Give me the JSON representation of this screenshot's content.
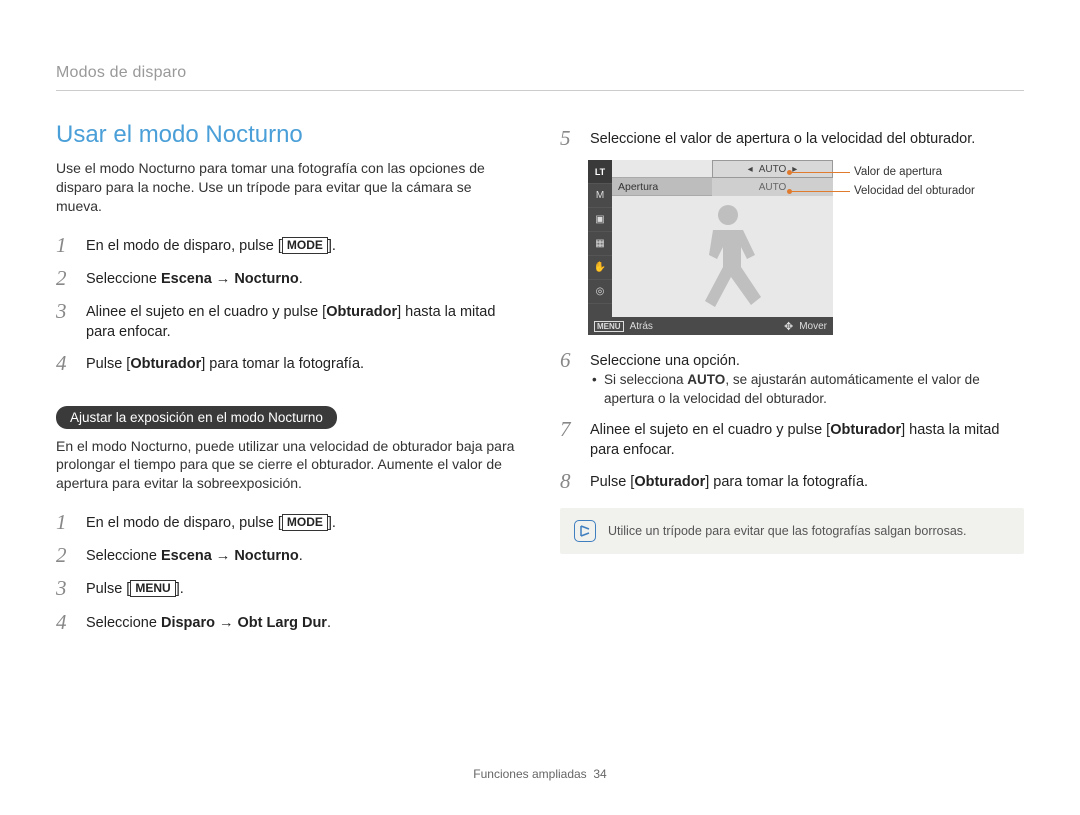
{
  "breadcrumb": "Modos de disparo",
  "section_title": "Usar el modo Nocturno",
  "intro": "Use el modo Nocturno para tomar una fotografía con las opciones de disparo para la noche. Use un trípode para evitar que la cámara se mueva.",
  "steps_a": [
    {
      "num": "1",
      "pre": "En el modo de disparo, pulse [",
      "key": "MODE",
      "post": "]."
    },
    {
      "num": "2",
      "html": "Seleccione <b>Escena</b> → <b>Nocturno</b>."
    },
    {
      "num": "3",
      "html": "Alinee el sujeto en el cuadro y pulse [<b>Obturador</b>] hasta la mitad para enfocar."
    },
    {
      "num": "4",
      "html": "Pulse [<b>Obturador</b>] para tomar la fotografía."
    }
  ],
  "pill": "Ajustar la exposición en el modo Nocturno",
  "sub_text": "En el modo Nocturno, puede utilizar una velocidad de obturador baja para prolongar el tiempo para que se cierre el obturador. Aumente el valor de apertura para evitar la sobreexposición.",
  "steps_b": [
    {
      "num": "1",
      "pre": "En el modo de disparo, pulse [",
      "key": "MODE",
      "post": "]."
    },
    {
      "num": "2",
      "html": "Seleccione <b>Escena</b> → <b>Nocturno</b>."
    },
    {
      "num": "3",
      "pre": "Pulse [",
      "key": "MENU",
      "post": "]."
    },
    {
      "num": "4",
      "html": "Seleccione <b>Disparo</b> → <b>Obt Larg Dur</b>."
    }
  ],
  "right": {
    "step5": {
      "num": "5",
      "text": "Seleccione el valor de apertura o la velocidad del obturador."
    },
    "screen": {
      "lt": "LT",
      "m": "M",
      "top_auto": "AUTO",
      "apertura": "Apertura",
      "row2_auto": "AUTO",
      "menu": "MENU",
      "atras": "Atrás",
      "mover": "Mover",
      "callout1": "Valor de apertura",
      "callout2": "Velocidad del obturador"
    },
    "step6": {
      "num": "6",
      "text": "Seleccione una opción."
    },
    "bullet": "Si selecciona <b>AUTO</b>, se ajustarán automáticamente el valor de apertura o la velocidad del obturador.",
    "step7": {
      "num": "7",
      "html": "Alinee el sujeto en el cuadro y pulse [<b>Obturador</b>] hasta la mitad para enfocar."
    },
    "step8": {
      "num": "8",
      "html": "Pulse [<b>Obturador</b>] para tomar la fotografía."
    },
    "note": "Utilice un trípode para evitar que las fotografías salgan borrosas."
  },
  "footer": {
    "label": "Funciones ampliadas",
    "page": "34"
  }
}
